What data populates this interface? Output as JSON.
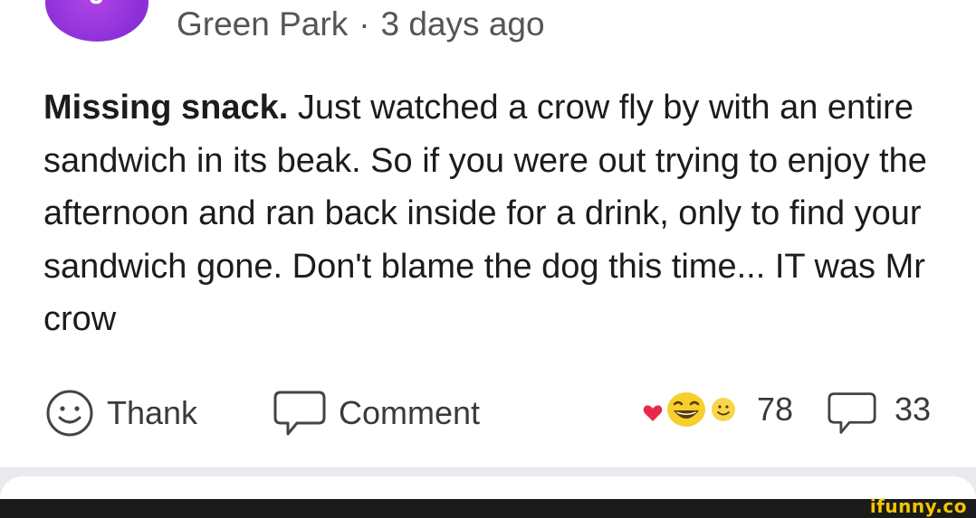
{
  "post": {
    "author_initial": "J",
    "location": "Green Park",
    "separator": "·",
    "time": "3 days ago",
    "title": "Missing snack.",
    "body": " Just watched a crow fly by with an entire sandwich in its beak. So if you were out trying to enjoy the afternoon and ran back inside for a drink, only to find your sandwich gone. Don't blame the dog this time... IT was Mr crow"
  },
  "actions": {
    "thank_label": "Thank",
    "comment_label": "Comment",
    "reaction_count": "78",
    "comment_count": "33"
  },
  "watermark": {
    "text": "ifunny.co"
  },
  "colors": {
    "avatar": "#9b3be0",
    "watermark": "#f4c600"
  }
}
